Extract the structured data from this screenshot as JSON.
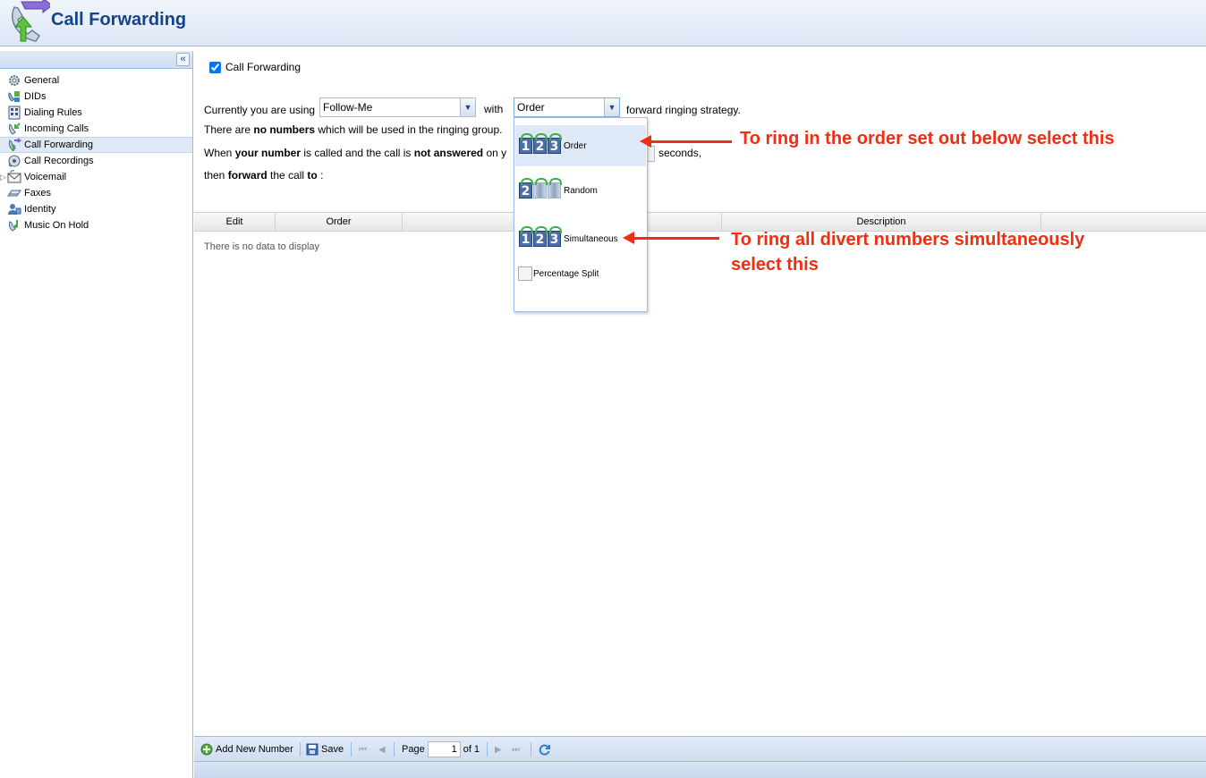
{
  "header": {
    "title": "Call Forwarding"
  },
  "sidebar": {
    "collapse_label": "«",
    "items": [
      {
        "label": "General",
        "icon": "gear-icon"
      },
      {
        "label": "DIDs",
        "icon": "did-icon"
      },
      {
        "label": "Dialing Rules",
        "icon": "dialing-rules-icon"
      },
      {
        "label": "Incoming Calls",
        "icon": "incoming-calls-icon"
      },
      {
        "label": "Call Forwarding",
        "icon": "call-forwarding-icon",
        "active": true
      },
      {
        "label": "Call Recordings",
        "icon": "recording-icon"
      },
      {
        "label": "Voicemail",
        "icon": "voicemail-icon"
      },
      {
        "label": "Faxes",
        "icon": "fax-icon"
      },
      {
        "label": "Identity",
        "icon": "identity-icon"
      },
      {
        "label": "Music On Hold",
        "icon": "music-icon"
      }
    ]
  },
  "main": {
    "enable_label": "Call Forwarding",
    "using_prefix": "Currently you are using",
    "mode_value": "Follow-Me",
    "with_label": "with",
    "strategy_value": "Order",
    "strategy_suffix": "forward ringing strategy.",
    "numbers_line": {
      "pre": "There are ",
      "bold": "no numbers",
      "post": " which will be used in the ringing group."
    },
    "when_line": {
      "a": "When ",
      "b": "your number",
      "c": " is called and the call is ",
      "d": "not answered",
      "e": " on y"
    },
    "seconds_label": "seconds,",
    "then_line": {
      "a": "then ",
      "b": "forward",
      "c": " the call ",
      "d": "to",
      "e": " :"
    },
    "grid": {
      "columns": [
        "Edit",
        "Order",
        "Description"
      ],
      "empty_text": "There is no data to display"
    }
  },
  "dropdown": {
    "options": [
      {
        "label": "Order",
        "selected": true
      },
      {
        "label": "Random"
      },
      {
        "label": "Simultaneous"
      },
      {
        "label": "Percentage Split"
      }
    ]
  },
  "toolbar": {
    "add_label": "Add New Number",
    "save_label": "Save",
    "page_label": "Page",
    "page_value": "1",
    "of_label": "of 1"
  },
  "annotations": {
    "order_note": "To ring in the order set out below select this",
    "simultaneous_note_line1": "To ring all divert numbers simultaneously",
    "simultaneous_note_line2": "select this"
  },
  "colors": {
    "accent": "#15428b",
    "annotation": "#ef2e12",
    "selected_row": "#dfe8f6"
  }
}
